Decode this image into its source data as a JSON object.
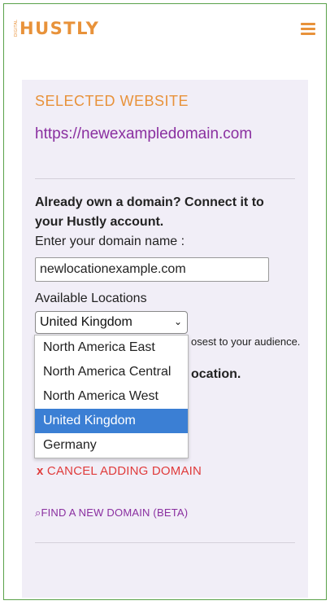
{
  "header": {
    "logo_tag": "DIGITAL",
    "logo_text": "HUSTLY",
    "menu_icon": "hamburger-icon"
  },
  "selected": {
    "label": "SELECTED WEBSITE",
    "url": "https://newexampledomain.com"
  },
  "connect": {
    "heading": "Already own a domain? Connect it to your Hustly account.",
    "input_label": "Enter your domain name :",
    "input_value": "newlocationexample.com"
  },
  "locations": {
    "label": "Available Locations",
    "selected": "United Kingdom",
    "options": [
      "North America East",
      "North America Central",
      "North America West",
      "United Kingdom",
      "Germany"
    ],
    "selected_index": 3,
    "hint_partial": "osest to your audience.",
    "hint2_partial": "ocation."
  },
  "actions": {
    "cancel_icon": "x",
    "cancel_label": "CANCEL ADDING DOMAIN",
    "find_icon": "⌕",
    "find_label": "FIND A NEW DOMAIN (BETA)"
  },
  "colors": {
    "brand_orange": "#e8923a",
    "purple": "#8a2fa0",
    "cancel_red": "#e03b3b",
    "panel_bg": "#f1eef7",
    "selected_option": "#3b7fd4",
    "frame_border": "#5aa14a"
  }
}
